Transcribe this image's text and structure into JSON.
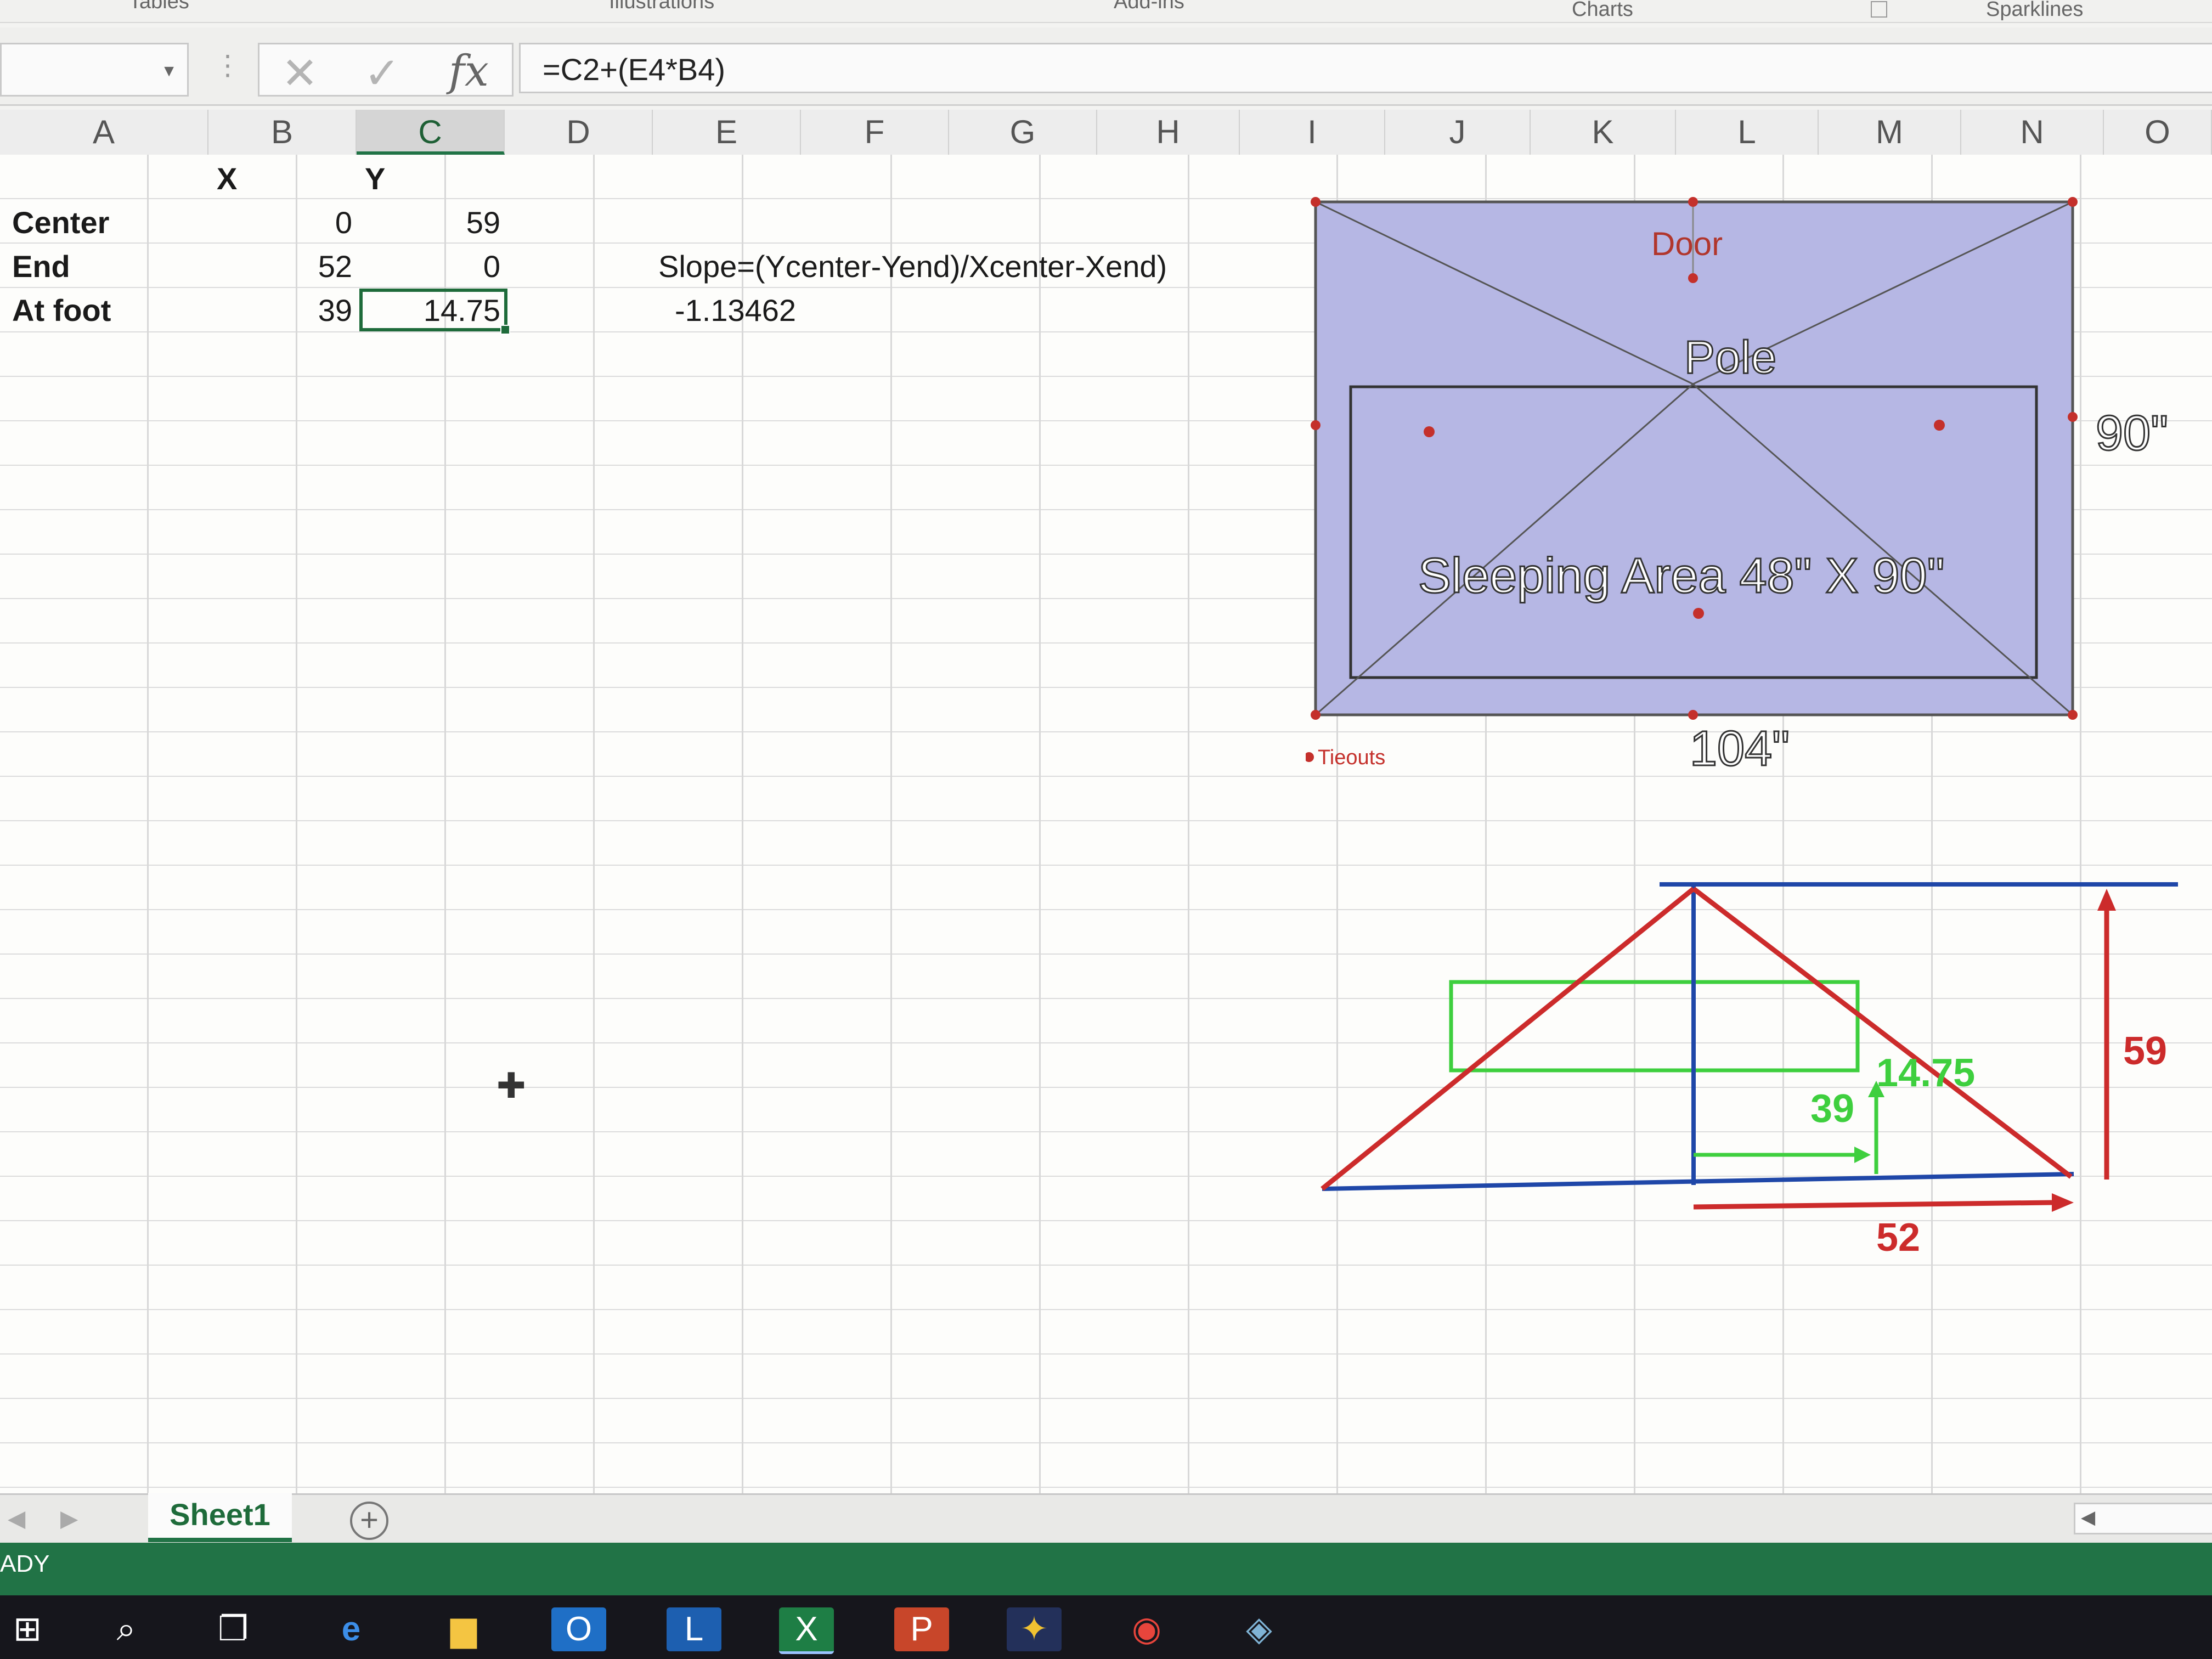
{
  "ribbon": {
    "groups": [
      "Tables",
      "Illustrations",
      "Add-ins",
      "Charts",
      "Sparklines"
    ]
  },
  "formula_bar": {
    "name_box": "",
    "cancel_glyph": "✕",
    "enter_glyph": "✓",
    "fx_label": "fx",
    "formula": "=C2+(E4*B4)"
  },
  "columns": [
    "A",
    "B",
    "C",
    "D",
    "E",
    "F",
    "G",
    "H",
    "I",
    "J",
    "K",
    "L",
    "M",
    "N",
    "O"
  ],
  "selected_column": "C",
  "cells": {
    "B1": "X",
    "C1": "Y",
    "A2": "Center",
    "B2": "0",
    "C2": "59",
    "A3": "End",
    "B3": "52",
    "C3": "0",
    "E3": "Slope=(Ycenter-Yend)/Xcenter-Xend)",
    "A4": "At foot",
    "B4": "39",
    "C4": "14.75",
    "E4": "-1.13462"
  },
  "floor_plan": {
    "door_label": "Door",
    "pole_label": "Pole",
    "sleeping_label": "Sleeping Area 48\" X 90\"",
    "width_label": "104\"",
    "height_label": "90\"",
    "legend_label": "Tieouts",
    "fill_color": "#b6b7e4",
    "dot_color": "#c4302b"
  },
  "triangle_diagram": {
    "height_label": "59",
    "base_label": "52",
    "foot_x_label": "39",
    "foot_y_label": "14.75",
    "red": "#cc2b2b",
    "blue": "#1f47a8",
    "green": "#3ecf3e"
  },
  "sheet_tabs": {
    "active": "Sheet1",
    "add_glyph": "+"
  },
  "status": {
    "text": "ADY"
  },
  "taskbar": {
    "items": [
      {
        "icon": "windows-start-icon",
        "glyph": "⊞"
      },
      {
        "icon": "search-icon",
        "glyph": "⌕"
      },
      {
        "icon": "task-view-icon",
        "glyph": "❐"
      },
      {
        "icon": "edge-icon",
        "glyph": "e"
      },
      {
        "icon": "file-explorer-icon",
        "glyph": "▆"
      },
      {
        "icon": "outlook-icon",
        "glyph": "O"
      },
      {
        "icon": "lync-icon",
        "glyph": "L"
      },
      {
        "icon": "excel-icon",
        "glyph": "X"
      },
      {
        "icon": "powerpoint-icon",
        "glyph": "P"
      },
      {
        "icon": "app-icon",
        "glyph": "✦"
      },
      {
        "icon": "chrome-icon",
        "glyph": "◉"
      },
      {
        "icon": "app-icon-2",
        "glyph": "◈"
      }
    ]
  }
}
